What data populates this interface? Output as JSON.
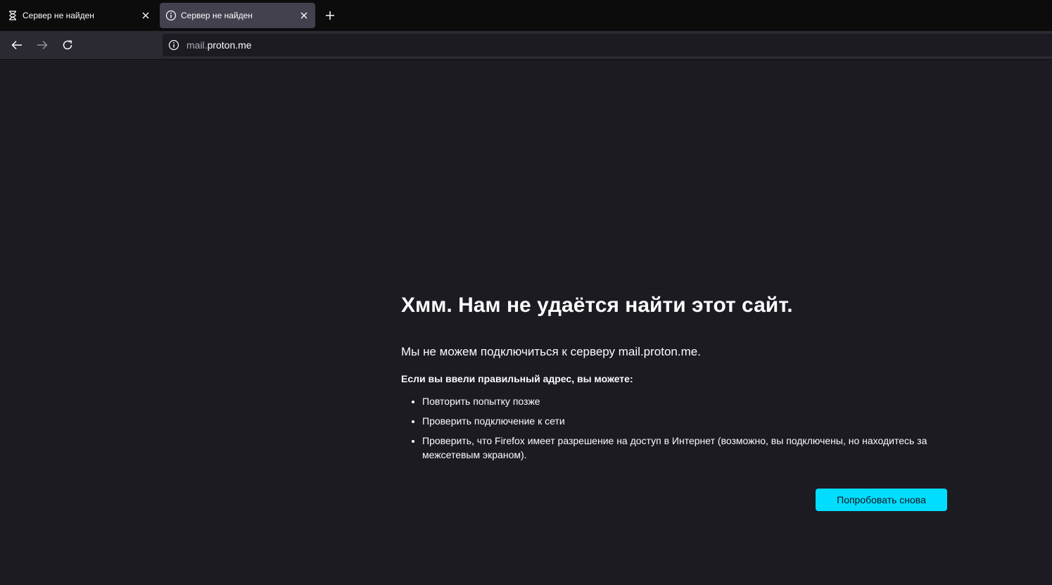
{
  "tabs": [
    {
      "label": "Сервер не найден",
      "icon": "hourglass-icon",
      "active": false
    },
    {
      "label": "Сервер не найден",
      "icon": "info-icon",
      "active": true
    }
  ],
  "nav": {
    "url_subdomain": "mail.",
    "url_host": "proton.me"
  },
  "error": {
    "title": "Хмм. Нам не удаётся найти этот сайт.",
    "description": "Мы не можем подключиться к серверу mail.proton.me.",
    "subtitle": "Если вы ввели правильный адрес, вы можете:",
    "tips": [
      "Повторить попытку позже",
      "Проверить подключение к сети",
      "Проверить, что Firefox имеет разрешение на доступ в Интернет (возможно, вы подключены, но находитесь за межсетевым экраном)."
    ],
    "retry_label": "Попробовать снова"
  },
  "colors": {
    "background": "#1c1b22",
    "tabbar": "#0c0c0d",
    "active_tab": "#42414d",
    "accent_button": "#00ddff"
  }
}
